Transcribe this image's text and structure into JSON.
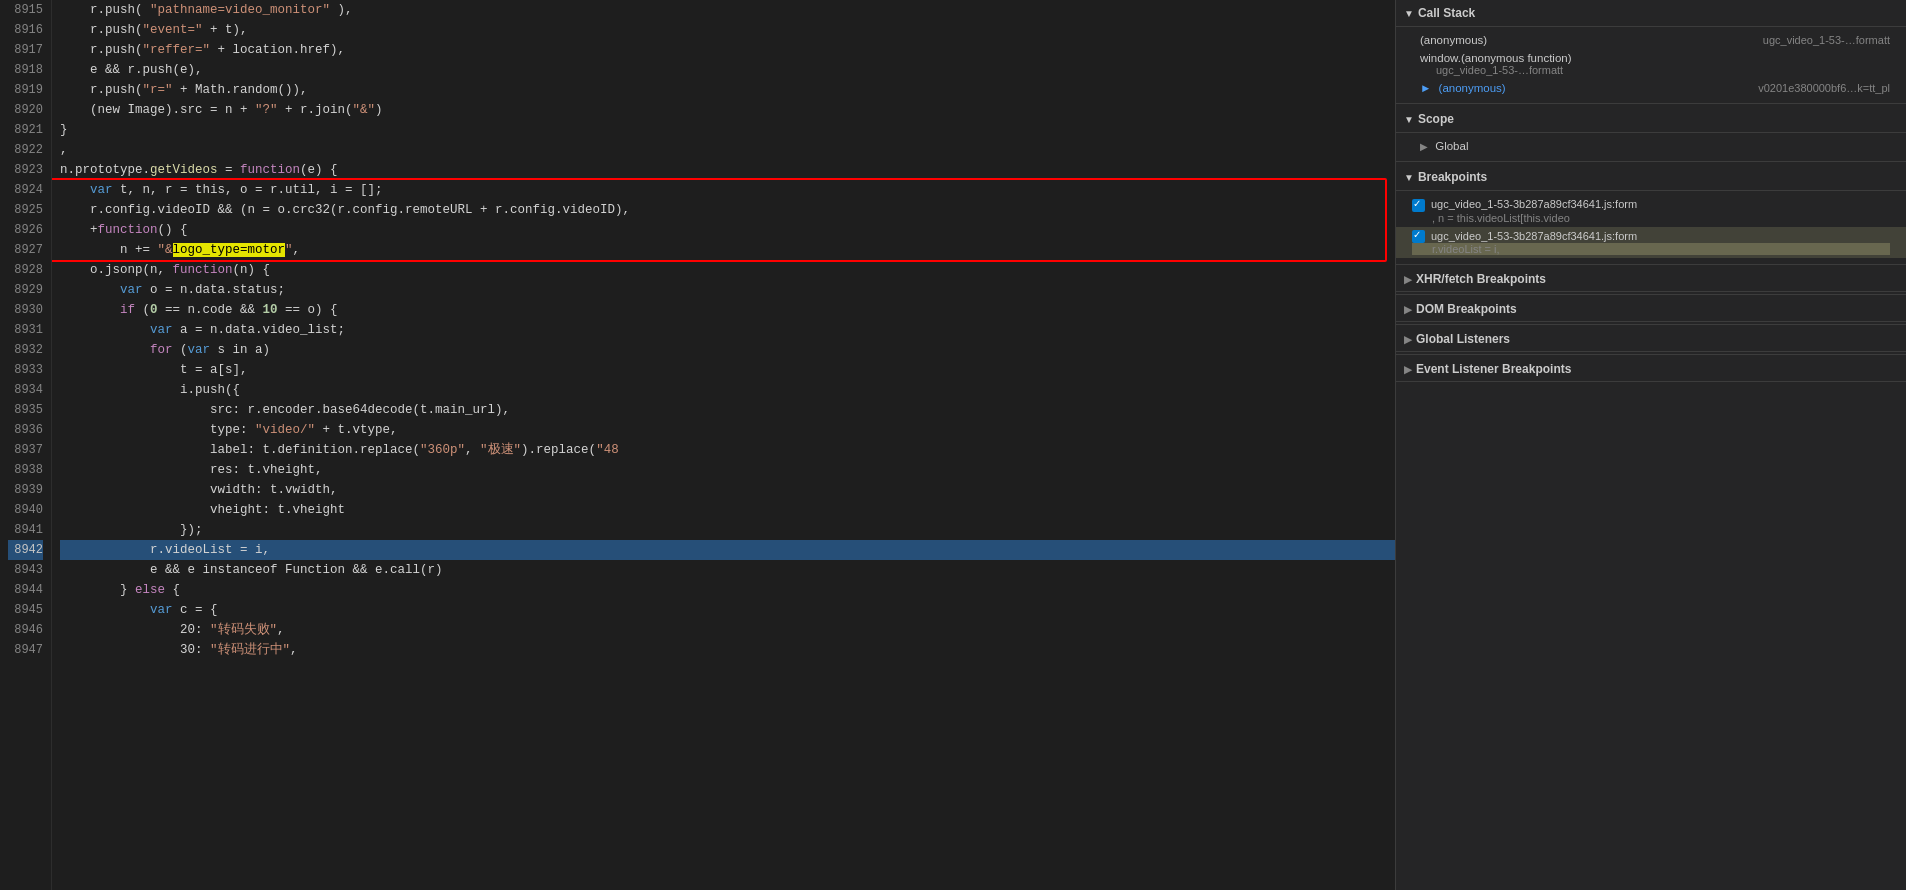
{
  "code": {
    "lines": [
      {
        "num": 8915,
        "content": "    r.push( \"pathname=video_monitor\" ),",
        "tokens": [
          {
            "t": "    r.push( ",
            "c": "c-white"
          },
          {
            "t": "\"pathname=video_monitor\"",
            "c": "c-string"
          },
          {
            "t": " ),",
            "c": "c-white"
          }
        ]
      },
      {
        "num": 8916,
        "content": "    r.push(\"event=\" + t),",
        "tokens": [
          {
            "t": "    r.push(",
            "c": "c-white"
          },
          {
            "t": "\"event=\"",
            "c": "c-string"
          },
          {
            "t": " + t),",
            "c": "c-white"
          }
        ]
      },
      {
        "num": 8917,
        "content": "    r.push(\"reffer=\" + location.href),",
        "tokens": [
          {
            "t": "    r.push(",
            "c": "c-white"
          },
          {
            "t": "\"reffer=\"",
            "c": "c-string"
          },
          {
            "t": " + location.href),",
            "c": "c-white"
          }
        ]
      },
      {
        "num": 8918,
        "content": "    e && r.push(e),",
        "tokens": [
          {
            "t": "    e && r.push(e),",
            "c": "c-white"
          }
        ]
      },
      {
        "num": 8919,
        "content": "    r.push(\"r=\" + Math.random()),",
        "tokens": [
          {
            "t": "    r.push(",
            "c": "c-white"
          },
          {
            "t": "\"r=\"",
            "c": "c-string"
          },
          {
            "t": " + Math.random()),",
            "c": "c-white"
          }
        ]
      },
      {
        "num": 8920,
        "content": "    (new Image).src = n + \"?\" + r.join(\"&\")",
        "tokens": [
          {
            "t": "    (new Image).src = n + ",
            "c": "c-white"
          },
          {
            "t": "\"?\"",
            "c": "c-string"
          },
          {
            "t": " + r.join(",
            "c": "c-white"
          },
          {
            "t": "\"&\"",
            "c": "c-string"
          },
          {
            "t": ")",
            "c": "c-white"
          }
        ]
      },
      {
        "num": 8921,
        "content": "}",
        "tokens": [
          {
            "t": "}",
            "c": "c-white"
          }
        ]
      },
      {
        "num": 8922,
        "content": ",",
        "tokens": [
          {
            "t": ",",
            "c": "c-white"
          }
        ]
      },
      {
        "num": 8923,
        "content": "n.prototype.getVideos = function(e) {",
        "tokens": [
          {
            "t": "n.prototype.",
            "c": "c-white"
          },
          {
            "t": "getVideos",
            "c": "c-func"
          },
          {
            "t": " = ",
            "c": "c-white"
          },
          {
            "t": "function",
            "c": "c-purple"
          },
          {
            "t": "(e) {",
            "c": "c-white"
          }
        ]
      },
      {
        "num": 8924,
        "content": "    var t, n, r = this, o = r.util, i = [];",
        "tokens": [
          {
            "t": "    ",
            "c": "c-white"
          },
          {
            "t": "var",
            "c": "c-blue"
          },
          {
            "t": " t, n, r = this, o = r.util, i = [];",
            "c": "c-white"
          }
        ],
        "redbox_start": true
      },
      {
        "num": 8925,
        "content": "    r.config.videoID && (n = o.crc32(r.config.remoteURL + r.config.videoID),",
        "tokens": [
          {
            "t": "    r.config.videoID && (n = o.crc32(r.config.remoteURL + r.config.videoID),",
            "c": "c-white"
          }
        ]
      },
      {
        "num": 8926,
        "content": "    +function() {",
        "tokens": [
          {
            "t": "    +",
            "c": "c-white"
          },
          {
            "t": "function",
            "c": "c-purple"
          },
          {
            "t": "() {",
            "c": "c-white"
          }
        ]
      },
      {
        "num": 8927,
        "content": "        n += \"&logo_type=motor\",",
        "tokens": [
          {
            "t": "        n += ",
            "c": "c-white"
          },
          {
            "t": "\"&",
            "c": "c-string"
          },
          {
            "t": "logo_type=motor",
            "c": "c-string",
            "highlight": true
          },
          {
            "t": "\"",
            "c": "c-string"
          },
          {
            "t": ",",
            "c": "c-white"
          }
        ],
        "redbox_end": true
      },
      {
        "num": 8928,
        "content": "    o.jsonp(n, function(n) {",
        "tokens": [
          {
            "t": "    o.jsonp(n, ",
            "c": "c-white"
          },
          {
            "t": "function",
            "c": "c-purple"
          },
          {
            "t": "(n) {",
            "c": "c-white"
          }
        ]
      },
      {
        "num": 8929,
        "content": "        var o = n.data.status;",
        "tokens": [
          {
            "t": "        ",
            "c": "c-white"
          },
          {
            "t": "var",
            "c": "c-blue"
          },
          {
            "t": " o = n.data.status;",
            "c": "c-white"
          }
        ]
      },
      {
        "num": 8930,
        "content": "        if (0 == n.code && 10 == o) {",
        "tokens": [
          {
            "t": "        ",
            "c": "c-white"
          },
          {
            "t": "if",
            "c": "c-purple"
          },
          {
            "t": " (",
            "c": "c-white"
          },
          {
            "t": "0",
            "c": "c-num c-bold"
          },
          {
            "t": " == n.code && ",
            "c": "c-white"
          },
          {
            "t": "10",
            "c": "c-num c-bold"
          },
          {
            "t": " == o) {",
            "c": "c-white"
          }
        ]
      },
      {
        "num": 8931,
        "content": "            var a = n.data.video_list;",
        "tokens": [
          {
            "t": "            ",
            "c": "c-white"
          },
          {
            "t": "var",
            "c": "c-blue"
          },
          {
            "t": " a = n.data.video_list;",
            "c": "c-white"
          }
        ]
      },
      {
        "num": 8932,
        "content": "            for (var s in a)",
        "tokens": [
          {
            "t": "            ",
            "c": "c-white"
          },
          {
            "t": "for",
            "c": "c-purple"
          },
          {
            "t": " (",
            "c": "c-white"
          },
          {
            "t": "var",
            "c": "c-blue"
          },
          {
            "t": " s in a)",
            "c": "c-white"
          }
        ]
      },
      {
        "num": 8933,
        "content": "                t = a[s],",
        "tokens": [
          {
            "t": "                t = a[s],",
            "c": "c-white"
          }
        ]
      },
      {
        "num": 8934,
        "content": "                i.push({",
        "tokens": [
          {
            "t": "                i.push({",
            "c": "c-white"
          }
        ]
      },
      {
        "num": 8935,
        "content": "                    src: r.encoder.base64decode(t.main_url),",
        "tokens": [
          {
            "t": "                    src: r.encoder.base64decode(t.main_url),",
            "c": "c-white"
          }
        ]
      },
      {
        "num": 8936,
        "content": "                    type: \"video/\" + t.vtype,",
        "tokens": [
          {
            "t": "                    type: ",
            "c": "c-white"
          },
          {
            "t": "\"video/\"",
            "c": "c-string"
          },
          {
            "t": " + t.vtype,",
            "c": "c-white"
          }
        ]
      },
      {
        "num": 8937,
        "content": "                    label: t.definition.replace(\"360p\", \"极速\").replace(\"48",
        "tokens": [
          {
            "t": "                    label: t.definition.replace(",
            "c": "c-white"
          },
          {
            "t": "\"360p\"",
            "c": "c-string"
          },
          {
            "t": ", ",
            "c": "c-white"
          },
          {
            "t": "\"极速\"",
            "c": "c-string"
          },
          {
            "t": ").replace(",
            "c": "c-white"
          },
          {
            "t": "\"48",
            "c": "c-string"
          }
        ]
      },
      {
        "num": 8938,
        "content": "                    res: t.vheight,",
        "tokens": [
          {
            "t": "                    res: t.vheight,",
            "c": "c-white"
          }
        ]
      },
      {
        "num": 8939,
        "content": "                    vwidth: t.vwidth,",
        "tokens": [
          {
            "t": "                    vwidth: t.vwidth,",
            "c": "c-white"
          }
        ]
      },
      {
        "num": 8940,
        "content": "                    vheight: t.vheight",
        "tokens": [
          {
            "t": "                    vheight: t.vheight",
            "c": "c-white"
          }
        ]
      },
      {
        "num": 8941,
        "content": "                });",
        "tokens": [
          {
            "t": "                });",
            "c": "c-white"
          }
        ]
      },
      {
        "num": 8942,
        "content": "            r.videoList = i,",
        "tokens": [
          {
            "t": "            r.videoList = i,",
            "c": "c-white"
          }
        ],
        "current": true
      },
      {
        "num": 8943,
        "content": "            e && e instanceof Function && e.call(r)",
        "tokens": [
          {
            "t": "            e && e instanceof Function && e.call(r)",
            "c": "c-white"
          }
        ]
      },
      {
        "num": 8944,
        "content": "        } else {",
        "tokens": [
          {
            "t": "        } ",
            "c": "c-white"
          },
          {
            "t": "else",
            "c": "c-purple"
          },
          {
            "t": " {",
            "c": "c-white"
          }
        ]
      },
      {
        "num": 8945,
        "content": "            var c = {",
        "tokens": [
          {
            "t": "            ",
            "c": "c-white"
          },
          {
            "t": "var",
            "c": "c-blue"
          },
          {
            "t": " c = {",
            "c": "c-white"
          }
        ]
      },
      {
        "num": 8946,
        "content": "                20: \"转码失败\",",
        "tokens": [
          {
            "t": "                20: ",
            "c": "c-white"
          },
          {
            "t": "\"转码失败\"",
            "c": "c-string"
          },
          {
            "t": ",",
            "c": "c-white"
          }
        ]
      },
      {
        "num": 8947,
        "content": "                30: \"转码进行中\",",
        "tokens": [
          {
            "t": "                30: ",
            "c": "c-white"
          },
          {
            "t": "\"转码进行中\"",
            "c": "c-string"
          },
          {
            "t": ",",
            "c": "c-white"
          }
        ]
      }
    ]
  },
  "right_panel": {
    "call_stack": {
      "title": "Call Stack",
      "items": [
        {
          "fn": "(anonymous)",
          "file": "ugc_video_1-53-…formatt",
          "active": false
        },
        {
          "fn": "window.(anonymous function)",
          "file": "ugc_video_1-53-…formatt",
          "active": false,
          "indent": true
        },
        {
          "fn": "(anonymous)",
          "file": "v0201e380000bf6…k=tt_pl",
          "active": true
        }
      ]
    },
    "scope": {
      "title": "Scope",
      "items": [
        {
          "label": "Global",
          "collapsed": true
        }
      ]
    },
    "breakpoints": {
      "title": "Breakpoints",
      "items": [
        {
          "checked": true,
          "file": "ugc_video_1-53-3b287a89cf34641.js:form",
          "code": ", n = this.videoList[this.video",
          "highlighted": false
        },
        {
          "checked": true,
          "file": "ugc_video_1-53-3b287a89cf34641.js:form",
          "code": "r.videoList = i,",
          "highlighted": true
        }
      ]
    },
    "xhr_breakpoints": {
      "title": "XHR/fetch Breakpoints",
      "collapsed": true
    },
    "dom_breakpoints": {
      "title": "DOM Breakpoints",
      "collapsed": true
    },
    "global_listeners": {
      "title": "Global Listeners",
      "collapsed": true
    },
    "event_listener_breakpoints": {
      "title": "Event Listener Breakpoints",
      "collapsed": true
    }
  }
}
